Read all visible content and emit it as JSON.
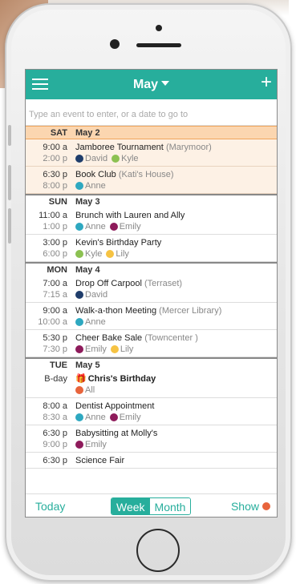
{
  "app": {
    "title": "May",
    "search": {
      "placeholder": "Type an event to enter, or a date to go to"
    },
    "bottom": {
      "today": "Today",
      "week": "Week",
      "month": "Month",
      "show": "Show"
    }
  },
  "colors": {
    "accent": "#27ae9c",
    "selected_day": "#fbd6b0",
    "david": "#1f3d6b",
    "kyle": "#8cc152",
    "anne": "#2ea8c0",
    "emily": "#8e1b5b",
    "lily": "#f6c343",
    "all": "#e8643c"
  },
  "days": [
    {
      "name": "SAT",
      "date": "May 2",
      "selected": true,
      "events": [
        {
          "t1": "9:00 a",
          "t2": "2:00 p",
          "title": "Jamboree Tournament",
          "loc": "(Marymoor)",
          "people": [
            {
              "name": "David",
              "color": "#1f3d6b"
            },
            {
              "name": "Kyle",
              "color": "#8cc152"
            }
          ]
        },
        {
          "t1": "6:30 p",
          "t2": "8:00 p",
          "title": "Book Club",
          "loc": "(Kati's House)",
          "people": [
            {
              "name": "Anne",
              "color": "#2ea8c0"
            }
          ]
        }
      ]
    },
    {
      "name": "SUN",
      "date": "May 3",
      "selected": false,
      "events": [
        {
          "t1": "11:00 a",
          "t2": "1:00 p",
          "title": "Brunch with Lauren and Ally",
          "loc": "",
          "people": [
            {
              "name": "Anne",
              "color": "#2ea8c0"
            },
            {
              "name": "Emily",
              "color": "#8e1b5b"
            }
          ]
        },
        {
          "t1": "3:00 p",
          "t2": "6:00 p",
          "title": "Kevin's Birthday Party",
          "loc": "",
          "people": [
            {
              "name": "Kyle",
              "color": "#8cc152"
            },
            {
              "name": "Lily",
              "color": "#f6c343"
            }
          ]
        }
      ]
    },
    {
      "name": "MON",
      "date": "May 4",
      "selected": false,
      "events": [
        {
          "t1": "7:00 a",
          "t2": "7:15 a",
          "title": "Drop Off Carpool",
          "loc": "(Terraset)",
          "people": [
            {
              "name": "David",
              "color": "#1f3d6b"
            }
          ]
        },
        {
          "t1": "9:00 a",
          "t2": "10:00 a",
          "title": "Walk-a-thon Meeting",
          "loc": "(Mercer Library)",
          "people": [
            {
              "name": "Anne",
              "color": "#2ea8c0"
            }
          ]
        },
        {
          "t1": "5:30 p",
          "t2": "7:30 p",
          "title": "Cheer Bake Sale",
          "loc": "(Towncenter )",
          "people": [
            {
              "name": "Emily",
              "color": "#8e1b5b"
            },
            {
              "name": "Lily",
              "color": "#f6c343"
            }
          ]
        }
      ]
    },
    {
      "name": "TUE",
      "date": "May 5",
      "selected": false,
      "events": [
        {
          "t1": "B-day",
          "t2": "",
          "title": "Chris's Birthday",
          "loc": "",
          "birthday": true,
          "gift_icon": "gift-icon",
          "people": [
            {
              "name": "All",
              "color": "#e8643c"
            }
          ]
        },
        {
          "t1": "8:00 a",
          "t2": "8:30 a",
          "title": "Dentist Appointment",
          "loc": "",
          "people": [
            {
              "name": "Anne",
              "color": "#2ea8c0"
            },
            {
              "name": "Emily",
              "color": "#8e1b5b"
            }
          ]
        },
        {
          "t1": "6:30 p",
          "t2": "9:00 p",
          "title": "Babysitting at Molly's",
          "loc": "",
          "people": [
            {
              "name": "Emily",
              "color": "#8e1b5b"
            }
          ]
        },
        {
          "t1": "6:30 p",
          "t2": "",
          "title": "Science Fair",
          "loc": "",
          "people": []
        }
      ]
    }
  ]
}
